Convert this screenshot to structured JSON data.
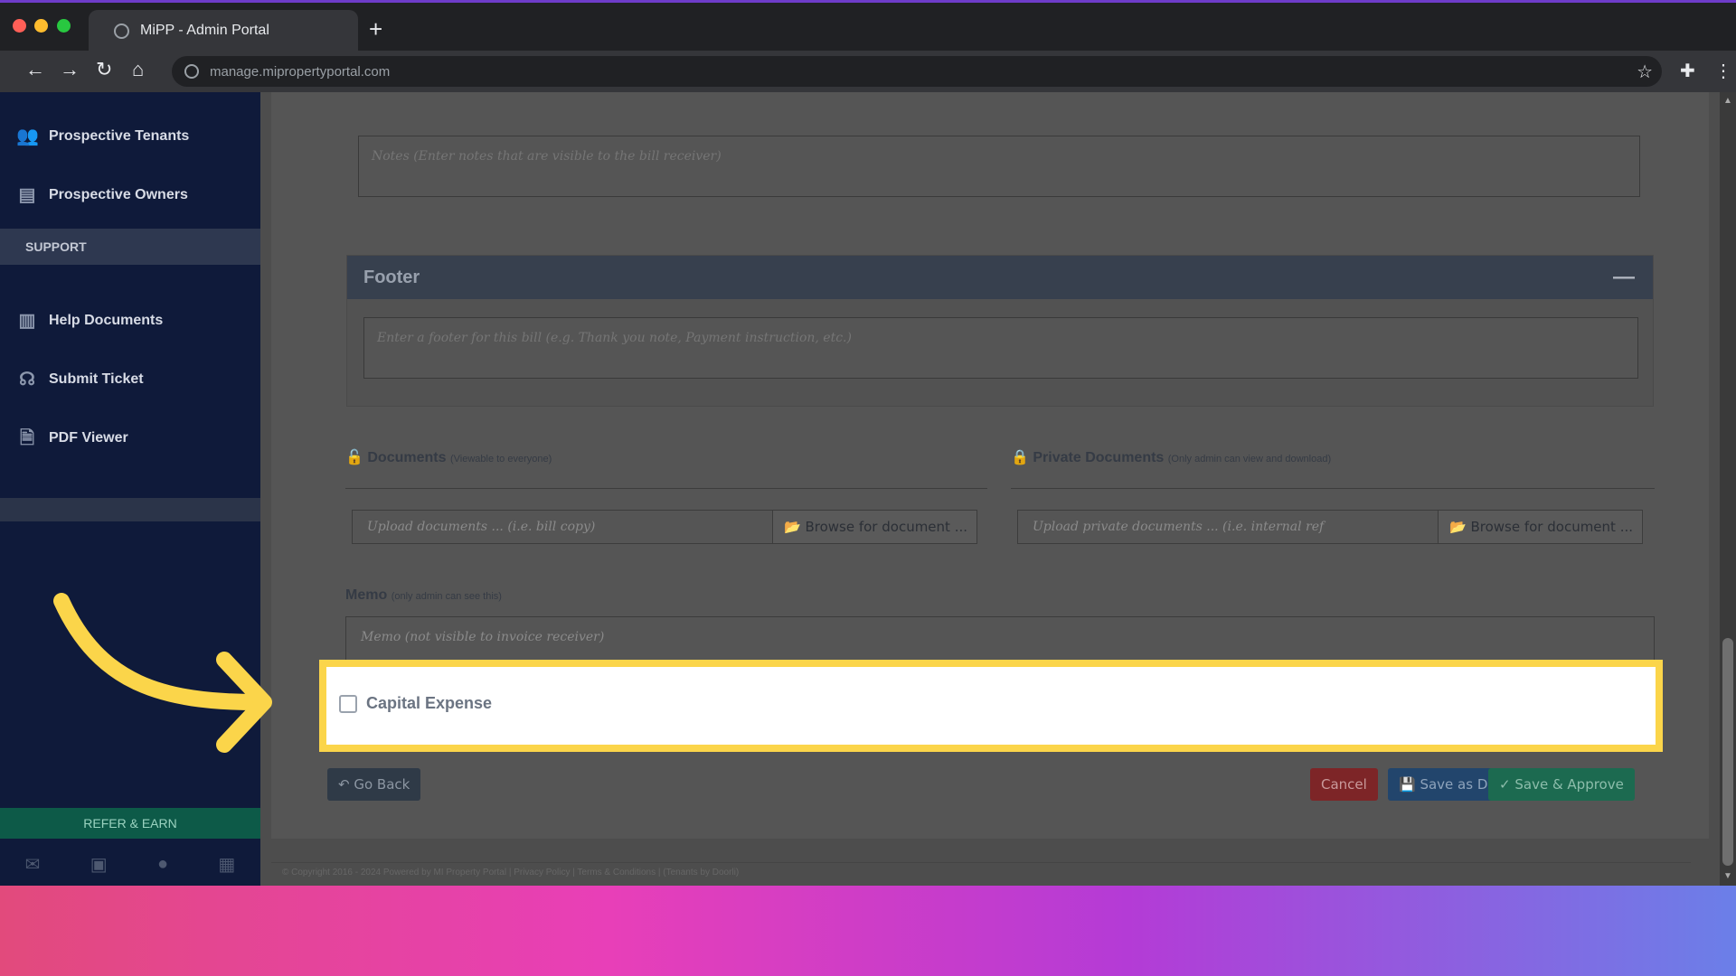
{
  "browser": {
    "tab_title": "MiPP - Admin Portal",
    "url": "manage.mipropertyportal.com"
  },
  "sidebar": {
    "items": [
      {
        "label": "Prospective Tenants",
        "icon": "users-icon"
      },
      {
        "label": "Prospective Owners",
        "icon": "id-card-icon"
      },
      {
        "label": "Help Documents",
        "icon": "book-icon"
      },
      {
        "label": "Submit Ticket",
        "icon": "headset-icon"
      },
      {
        "label": "PDF Viewer",
        "icon": "file-pdf-icon"
      }
    ],
    "section_support": "SUPPORT",
    "refer_label": "REFER & EARN",
    "footer_icons": [
      "envelope-icon",
      "briefcase-icon",
      "user-icon",
      "calculator-icon"
    ]
  },
  "form": {
    "notes_placeholder": "Notes (Enter notes that are visible to the bill receiver)",
    "footer_title": "Footer",
    "footer_placeholder": "Enter a footer for this bill (e.g. Thank you note, Payment instruction, etc.)",
    "documents_title": "Documents",
    "documents_hint": "(Viewable to everyone)",
    "documents_placeholder": "Upload documents ... (i.e. bill copy)",
    "private_title": "Private Documents",
    "private_hint": "(Only admin can view and download)",
    "private_placeholder": "Upload private documents ... (i.e. internal ref",
    "browse_label": "Browse for document ...",
    "memo_title": "Memo",
    "memo_hint": "(only admin can see this)",
    "memo_placeholder": "Memo (not visible to invoice receiver)",
    "capital_expense_label": "Capital Expense",
    "capital_expense_checked": false
  },
  "actions": {
    "go_back": "Go Back",
    "cancel": "Cancel",
    "save_draft": "Save as Draft",
    "save_approve": "Save & Approve"
  },
  "copyright": "© Copyright 2016 - 2024 Powered by MI Property Portal | Privacy Policy | Terms & Conditions | (Tenants by Doorli)",
  "colors": {
    "highlight": "#fbd54a",
    "arrow": "#fbd54a"
  }
}
